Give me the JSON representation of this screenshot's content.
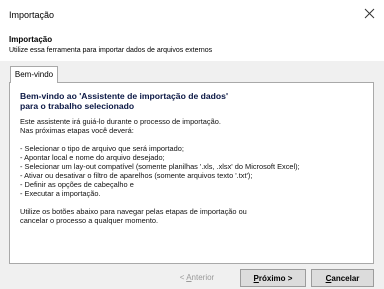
{
  "window": {
    "title": "Importação"
  },
  "header": {
    "title": "Importação",
    "subtitle": "Utilize essa ferramenta para importar dados de arquivos externos"
  },
  "tab": {
    "label": "Bem-vindo"
  },
  "content": {
    "welcome_line1": "Bem-vindo ao 'Assistente de importação de dados'",
    "welcome_line2": "para o trabalho selecionado",
    "intro1": "Este assistente irá guiá-lo durante o processo de importação.",
    "intro2": "Nas próximas etapas você deverá:",
    "steps": [
      "- Selecionar o tipo de arquivo que será importado;",
      "- Apontar local e nome do arquivo desejado;",
      "- Selecionar um lay-out compatível (somente planilhas '.xls, .xlsx' do Microsoft Excel);",
      "- Ativar ou desativar o filtro de aparelhos (somente arquivos texto '.txt');",
      "- Definir as opções de cabeçalho e",
      "- Executar a importação."
    ],
    "footer1": "Utilize os botões abaixo para navegar pelas etapas de importação ou",
    "footer2": "cancelar o processo a qualquer momento."
  },
  "buttons": {
    "back": {
      "prefix": "< ",
      "mnemonic": "A",
      "rest": "nterior"
    },
    "next": {
      "mnemonic": "P",
      "rest": "róximo >"
    },
    "cancel": {
      "mnemonic": "C",
      "rest": "ancelar"
    }
  }
}
